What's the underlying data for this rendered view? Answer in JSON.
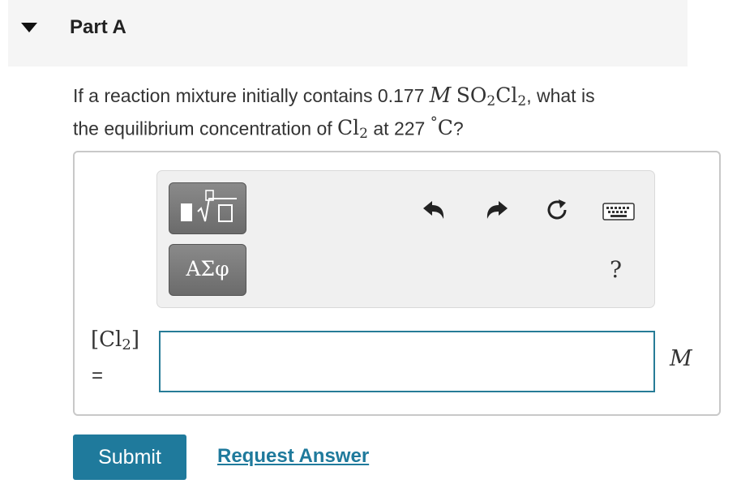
{
  "part": {
    "title": "Part A"
  },
  "question": {
    "text_1": "If a reaction mixture initially contains 0.177",
    "unit_M": "M",
    "species_1_base": "SO",
    "species_1_sub1": "2",
    "species_1_mid": "Cl",
    "species_1_sub2": "2",
    "text_2": ", what is",
    "text_3": "the equilibrium concentration of",
    "species_2_base": "Cl",
    "species_2_sub": "2",
    "text_4": "at 227",
    "degree": "°",
    "temp_unit": "C",
    "text_5": "?"
  },
  "toolbar": {
    "templates_icon": "fraction-sqrt-template-icon",
    "symbols_label": "ΑΣφ",
    "undo_icon": "undo-icon",
    "redo_icon": "redo-icon",
    "reset_icon": "reset-icon",
    "keyboard_icon": "keyboard-icon",
    "help_label": "?"
  },
  "answer": {
    "variable_open": "[Cl",
    "variable_sub": "2",
    "variable_close": "]",
    "equals": "=",
    "value": "",
    "unit": "M"
  },
  "actions": {
    "submit_label": "Submit",
    "request_label": "Request Answer"
  },
  "colors": {
    "accent": "#1f7a9c",
    "input_border": "#277c97",
    "header_bg": "#f5f5f5",
    "toolbar_bg": "#f0f0f0"
  }
}
